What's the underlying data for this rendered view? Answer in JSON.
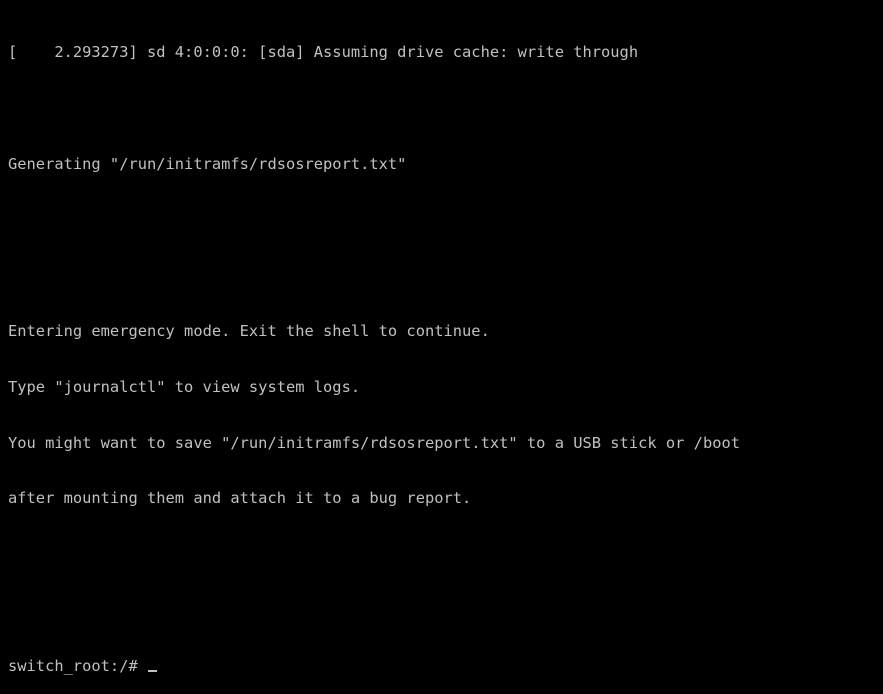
{
  "console": {
    "lines": [
      "[    2.293273] sd 4:0:0:0: [sda] Assuming drive cache: write through",
      "",
      "Generating \"/run/initramfs/rdsosreport.txt\"",
      "",
      "",
      "Entering emergency mode. Exit the shell to continue.",
      "Type \"journalctl\" to view system logs.",
      "You might want to save \"/run/initramfs/rdsosreport.txt\" to a USB stick or /boot",
      "after mounting them and attach it to a bug report.",
      "",
      ""
    ],
    "prompt": "switch_root:/#",
    "input_value": ""
  },
  "colors": {
    "background": "#000000",
    "text": "#c0c0c0"
  }
}
